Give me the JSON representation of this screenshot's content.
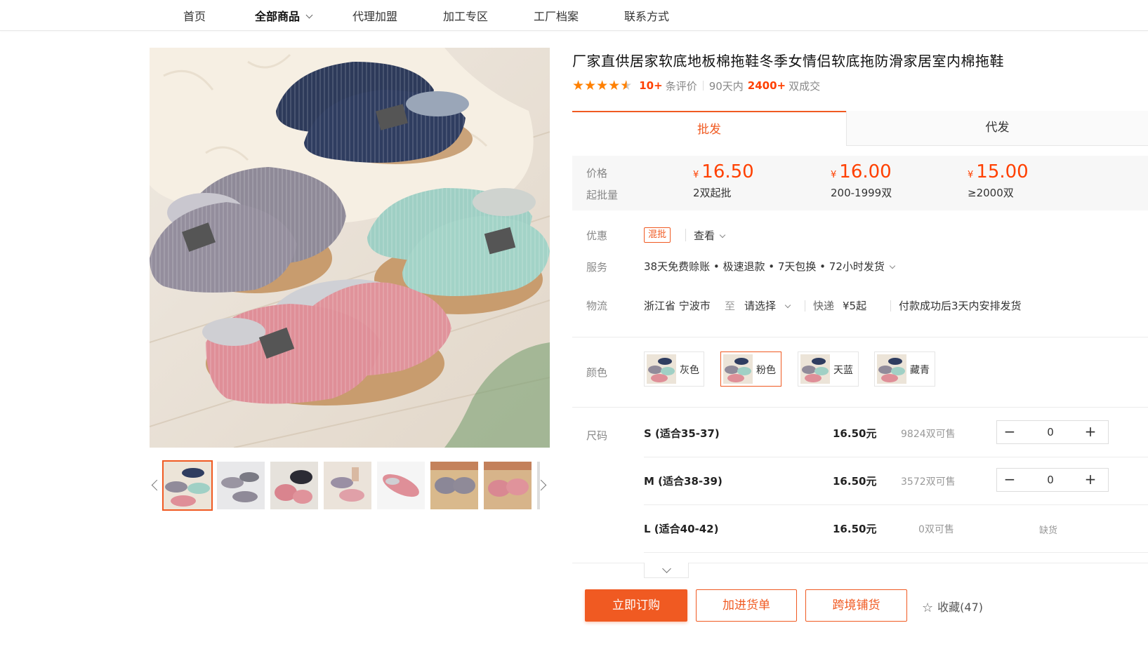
{
  "nav": {
    "items": [
      "首页",
      "全部商品",
      "代理加盟",
      "加工专区",
      "工厂档案",
      "联系方式"
    ],
    "active_index": 1
  },
  "product": {
    "title": "厂家直供居家软底地板棉拖鞋冬季女情侣软底拖防滑家居室内棉拖鞋",
    "rating_stars": 4.5,
    "review_count": "10+",
    "review_label": "条评价",
    "sales_prefix": "90天内",
    "sales_count": "2400+",
    "sales_suffix": "双成交"
  },
  "tabs": [
    "批发",
    "代发"
  ],
  "price": {
    "label_price": "价格",
    "label_moq": "起批量",
    "currency": "¥",
    "tiers": [
      {
        "price": "16.50",
        "qty": "2双起批"
      },
      {
        "price": "16.00",
        "qty": "200-1999双"
      },
      {
        "price": "15.00",
        "qty": "≥2000双"
      }
    ]
  },
  "promo": {
    "label": "优惠",
    "tag": "混批",
    "link": "查看"
  },
  "service": {
    "label": "服务",
    "text": "38天免费赊账 • 极速退款 • 7天包换 • 72小时发货"
  },
  "logistics": {
    "label": "物流",
    "from": "浙江省 宁波市",
    "to_word": "至",
    "select": "请选择",
    "express": "快递",
    "fee": "¥5起",
    "ship_note": "付款成功后3天内安排发货"
  },
  "colors": {
    "label": "颜色",
    "options": [
      "灰色",
      "粉色",
      "天蓝",
      "藏青"
    ],
    "selected_index": 1
  },
  "sizes": {
    "label": "尺码",
    "unit_price_suffix": "元",
    "rows": [
      {
        "name": "S (适合35-37)",
        "price": "16.50元",
        "stock": "9824双可售",
        "qty": "0",
        "out_of_stock": false
      },
      {
        "name": "M (适合38-39)",
        "price": "16.50元",
        "stock": "3572双可售",
        "qty": "0",
        "out_of_stock": false
      },
      {
        "name": "L (适合40-42)",
        "price": "16.50元",
        "stock": "0双可售",
        "qty": "",
        "out_of_stock": true,
        "oos_label": "缺货"
      }
    ]
  },
  "actions": {
    "buy": "立即订购",
    "cart": "加进货单",
    "cross": "跨境铺货",
    "fav": "收藏(47)"
  },
  "stepper": {
    "minus": "−",
    "plus": "+"
  },
  "palette": {
    "accent": "#f05a22",
    "price": "#ff4000",
    "star": "#ff8000"
  }
}
